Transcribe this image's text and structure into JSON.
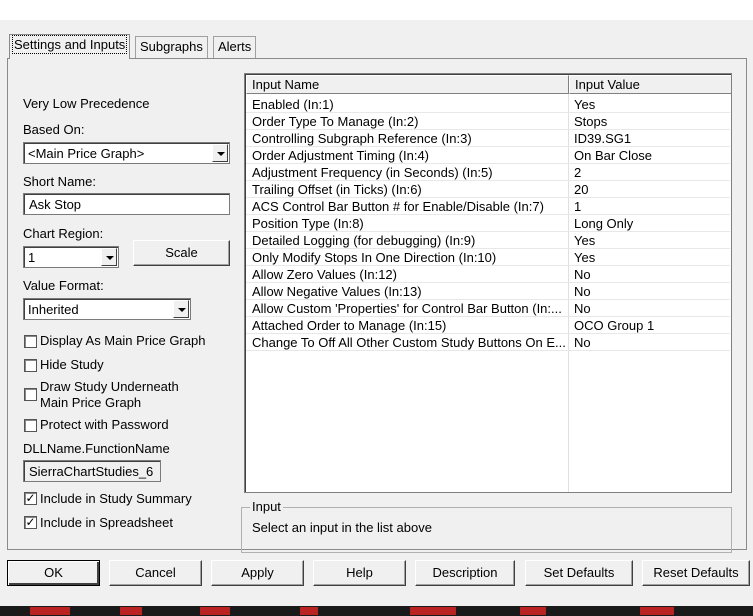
{
  "tabs": [
    {
      "label": "Settings and Inputs",
      "active": true
    },
    {
      "label": "Subgraphs",
      "active": false
    },
    {
      "label": "Alerts",
      "active": false
    }
  ],
  "study": {
    "name": "Very Low Precedence",
    "based_on_label": "Based On:",
    "based_on_value": "<Main Price Graph>",
    "short_name_label": "Short Name:",
    "short_name_value": "Ask Stop",
    "chart_region_label": "Chart Region:",
    "chart_region_value": "1",
    "scale_button": "Scale",
    "value_format_label": "Value Format:",
    "value_format_value": "Inherited",
    "dll_label": "DLLName.FunctionName",
    "dll_value": "SierraChartStudies_6"
  },
  "checkboxes": [
    {
      "label": "Display As Main Price Graph",
      "checked": false
    },
    {
      "label": "Hide Study",
      "checked": false
    },
    {
      "label": "Draw Study Underneath",
      "label2": "Main Price Graph",
      "checked": false
    },
    {
      "label": "Protect with Password",
      "checked": false
    },
    {
      "label": "Include in Study Summary",
      "checked": true
    },
    {
      "label": "Include in Spreadsheet",
      "checked": true
    }
  ],
  "inputs": {
    "header_name": "Input Name",
    "header_value": "Input Value",
    "rows": [
      {
        "name": "Enabled  (In:1)",
        "value": "Yes"
      },
      {
        "name": "Order Type To Manage  (In:2)",
        "value": "Stops"
      },
      {
        "name": "Controlling Subgraph Reference  (In:3)",
        "value": "ID39.SG1"
      },
      {
        "name": "Order Adjustment Timing  (In:4)",
        "value": "On Bar Close"
      },
      {
        "name": "Adjustment Frequency (in Seconds)  (In:5)",
        "value": "2"
      },
      {
        "name": "Trailing Offset (in Ticks)  (In:6)",
        "value": "20"
      },
      {
        "name": "ACS Control Bar Button # for Enable/Disable  (In:7)",
        "value": "1"
      },
      {
        "name": "Position Type  (In:8)",
        "value": "Long Only"
      },
      {
        "name": "Detailed Logging (for debugging)  (In:9)",
        "value": "Yes"
      },
      {
        "name": "Only Modify Stops In One Direction  (In:10)",
        "value": "Yes"
      },
      {
        "name": "Allow Zero Values  (In:12)",
        "value": "No"
      },
      {
        "name": "Allow Negative Values  (In:13)",
        "value": "No"
      },
      {
        "name": "Allow Custom 'Properties' for Control Bar Button  (In:...",
        "value": "No"
      },
      {
        "name": "Attached Order to Manage  (In:15)",
        "value": "OCO Group 1"
      },
      {
        "name": "Change To Off All Other Custom Study Buttons On E...",
        "value": "No"
      }
    ]
  },
  "input_group": {
    "title": "Input",
    "message": "Select an input in the list above"
  },
  "buttons": {
    "ok": "OK",
    "cancel": "Cancel",
    "apply": "Apply",
    "help": "Help",
    "description": "Description",
    "set_defaults": "Set Defaults",
    "reset_defaults": "Reset Defaults"
  }
}
